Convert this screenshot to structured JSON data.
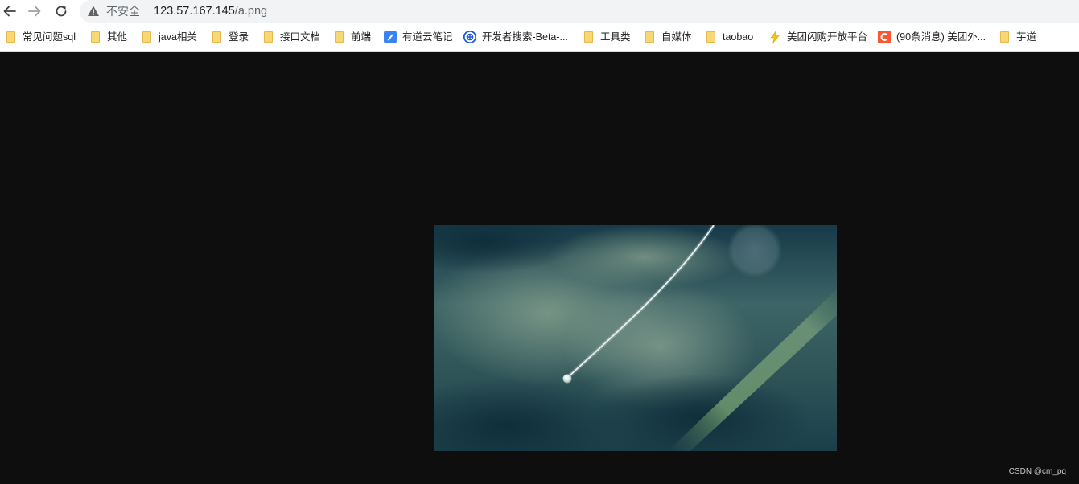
{
  "browser": {
    "nav": {
      "back_icon": "arrow-left-icon",
      "forward_icon": "arrow-right-icon",
      "reload_icon": "reload-icon"
    },
    "omnibox": {
      "warning_icon": "warning-triangle-icon",
      "security_label": "不安全",
      "host": "123.57.167.145",
      "path": "/a.png"
    },
    "bookmarks": [
      {
        "label": "常见问题sql",
        "icon": "folder-icon"
      },
      {
        "label": "其他",
        "icon": "folder-icon"
      },
      {
        "label": "java相关",
        "icon": "folder-icon"
      },
      {
        "label": "登录",
        "icon": "folder-icon"
      },
      {
        "label": "接口文档",
        "icon": "folder-icon"
      },
      {
        "label": "前端",
        "icon": "folder-icon"
      },
      {
        "label": "有道云笔记",
        "icon": "youdao-note-icon"
      },
      {
        "label": "开发者搜索-Beta-...",
        "icon": "dev-search-icon"
      },
      {
        "label": "工具类",
        "icon": "folder-icon"
      },
      {
        "label": "自媒体",
        "icon": "folder-icon"
      },
      {
        "label": "taobao",
        "icon": "folder-icon"
      },
      {
        "label": "美团闪购开放平台",
        "icon": "meituan-flash-icon"
      },
      {
        "label": "(90条消息) 美团外...",
        "icon": "csdn-icon"
      },
      {
        "label": "芋道",
        "icon": "folder-icon"
      }
    ]
  },
  "content": {
    "image_icon": "water-droplet-photo",
    "watermark": "CSDN @cm_pq"
  },
  "colors": {
    "page_background": "#0e0e0e",
    "omnibox_background": "#f1f3f4",
    "folder": "#f8d775",
    "youdao": "#3b82f6",
    "dev_search": "#1a56db",
    "csdn": "#fc5531"
  }
}
